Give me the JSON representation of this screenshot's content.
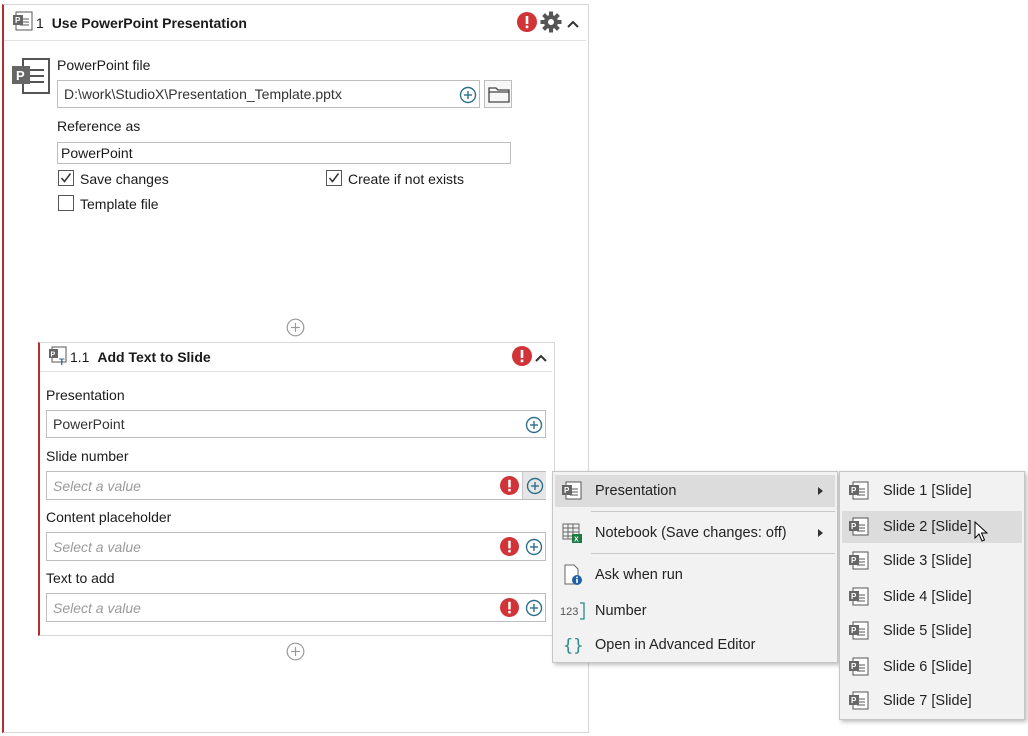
{
  "activity": {
    "number": "1",
    "title": "Use PowerPoint Presentation",
    "powerpoint_file_label": "PowerPoint file",
    "powerpoint_file_value": "D:\\work\\StudioX\\Presentation_Template.pptx",
    "reference_as_label": "Reference as",
    "reference_as_value": "PowerPoint",
    "save_changes_label": "Save changes",
    "save_changes_checked": true,
    "create_if_not_exists_label": "Create if not exists",
    "create_if_not_exists_checked": true,
    "template_file_label": "Template file",
    "template_file_checked": false
  },
  "child_activity": {
    "number": "1.1",
    "title": "Add Text to Slide",
    "presentation_label": "Presentation",
    "presentation_value": "PowerPoint",
    "slide_number_label": "Slide number",
    "slide_number_placeholder": "Select a value",
    "content_placeholder_label": "Content placeholder",
    "content_placeholder_placeholder": "Select a value",
    "text_to_add_label": "Text to add",
    "text_to_add_placeholder": "Select a value"
  },
  "context_menu": {
    "items": [
      {
        "label": "Presentation",
        "icon": "powerpoint-icon",
        "has_submenu": true,
        "highlighted": true
      },
      {
        "label": "Notebook (Save changes: off)",
        "icon": "excel-notebook-icon",
        "has_submenu": true
      },
      {
        "label": "Ask when run",
        "icon": "ask-document-icon",
        "has_submenu": false
      },
      {
        "label": "Number",
        "icon": "number-icon",
        "has_submenu": false
      },
      {
        "label": "Open in Advanced Editor",
        "icon": "braces-icon",
        "has_submenu": false
      }
    ]
  },
  "submenu": {
    "items": [
      {
        "label": "Slide 1 [Slide]"
      },
      {
        "label": "Slide 2 [Slide]",
        "highlighted": true
      },
      {
        "label": "Slide 3 [Slide]"
      },
      {
        "label": "Slide 4 [Slide]"
      },
      {
        "label": "Slide 5 [Slide]"
      },
      {
        "label": "Slide 6 [Slide]"
      },
      {
        "label": "Slide 7 [Slide]"
      }
    ]
  },
  "colors": {
    "error": "#d13438",
    "accent_border": "#b03030",
    "plus_circle": "#2d6f8a",
    "menu_bg": "#f2f2f2",
    "menu_highlight": "#dcdcdc"
  }
}
